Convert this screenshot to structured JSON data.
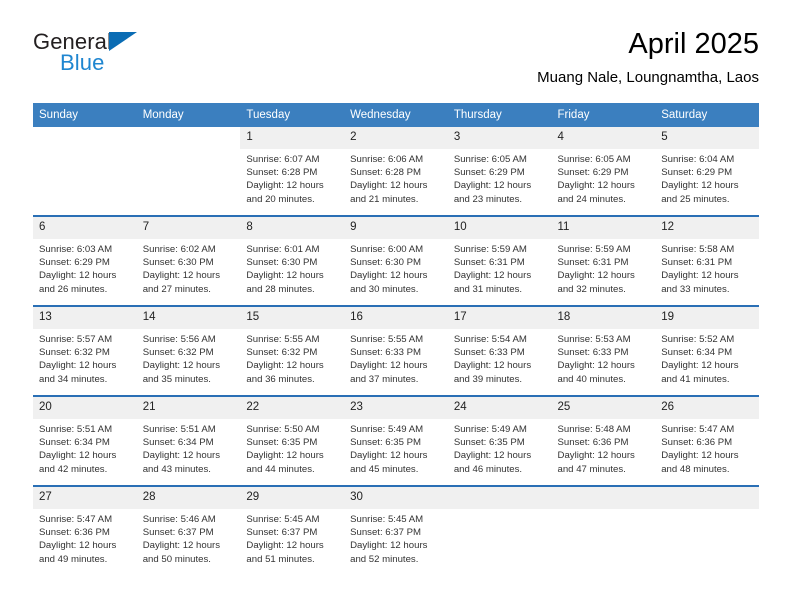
{
  "brand": {
    "name_part1": "General",
    "name_part2": "Blue",
    "triangle_icon": "logo-triangle-icon",
    "color_dark": "#231f20",
    "color_blue": "#1f86d0"
  },
  "header": {
    "title": "April 2025",
    "subtitle": "Muang Nale, Loungnamtha, Laos"
  },
  "theme": {
    "header_blue": "#3b7fbf",
    "row_divider_blue": "#2a6fb5",
    "daynum_bg": "#f0f0f0"
  },
  "calendar": {
    "weekday_headers": [
      "Sunday",
      "Monday",
      "Tuesday",
      "Wednesday",
      "Thursday",
      "Friday",
      "Saturday"
    ],
    "weeks": [
      [
        {
          "day": "",
          "sunrise": "",
          "sunset": "",
          "daylight_line1": "",
          "daylight_line2": "",
          "blank": true
        },
        {
          "day": "",
          "sunrise": "",
          "sunset": "",
          "daylight_line1": "",
          "daylight_line2": "",
          "blank": true
        },
        {
          "day": "1",
          "sunrise": "Sunrise: 6:07 AM",
          "sunset": "Sunset: 6:28 PM",
          "daylight_line1": "Daylight: 12 hours",
          "daylight_line2": "and 20 minutes."
        },
        {
          "day": "2",
          "sunrise": "Sunrise: 6:06 AM",
          "sunset": "Sunset: 6:28 PM",
          "daylight_line1": "Daylight: 12 hours",
          "daylight_line2": "and 21 minutes."
        },
        {
          "day": "3",
          "sunrise": "Sunrise: 6:05 AM",
          "sunset": "Sunset: 6:29 PM",
          "daylight_line1": "Daylight: 12 hours",
          "daylight_line2": "and 23 minutes."
        },
        {
          "day": "4",
          "sunrise": "Sunrise: 6:05 AM",
          "sunset": "Sunset: 6:29 PM",
          "daylight_line1": "Daylight: 12 hours",
          "daylight_line2": "and 24 minutes."
        },
        {
          "day": "5",
          "sunrise": "Sunrise: 6:04 AM",
          "sunset": "Sunset: 6:29 PM",
          "daylight_line1": "Daylight: 12 hours",
          "daylight_line2": "and 25 minutes."
        }
      ],
      [
        {
          "day": "6",
          "sunrise": "Sunrise: 6:03 AM",
          "sunset": "Sunset: 6:29 PM",
          "daylight_line1": "Daylight: 12 hours",
          "daylight_line2": "and 26 minutes."
        },
        {
          "day": "7",
          "sunrise": "Sunrise: 6:02 AM",
          "sunset": "Sunset: 6:30 PM",
          "daylight_line1": "Daylight: 12 hours",
          "daylight_line2": "and 27 minutes."
        },
        {
          "day": "8",
          "sunrise": "Sunrise: 6:01 AM",
          "sunset": "Sunset: 6:30 PM",
          "daylight_line1": "Daylight: 12 hours",
          "daylight_line2": "and 28 minutes."
        },
        {
          "day": "9",
          "sunrise": "Sunrise: 6:00 AM",
          "sunset": "Sunset: 6:30 PM",
          "daylight_line1": "Daylight: 12 hours",
          "daylight_line2": "and 30 minutes."
        },
        {
          "day": "10",
          "sunrise": "Sunrise: 5:59 AM",
          "sunset": "Sunset: 6:31 PM",
          "daylight_line1": "Daylight: 12 hours",
          "daylight_line2": "and 31 minutes."
        },
        {
          "day": "11",
          "sunrise": "Sunrise: 5:59 AM",
          "sunset": "Sunset: 6:31 PM",
          "daylight_line1": "Daylight: 12 hours",
          "daylight_line2": "and 32 minutes."
        },
        {
          "day": "12",
          "sunrise": "Sunrise: 5:58 AM",
          "sunset": "Sunset: 6:31 PM",
          "daylight_line1": "Daylight: 12 hours",
          "daylight_line2": "and 33 minutes."
        }
      ],
      [
        {
          "day": "13",
          "sunrise": "Sunrise: 5:57 AM",
          "sunset": "Sunset: 6:32 PM",
          "daylight_line1": "Daylight: 12 hours",
          "daylight_line2": "and 34 minutes."
        },
        {
          "day": "14",
          "sunrise": "Sunrise: 5:56 AM",
          "sunset": "Sunset: 6:32 PM",
          "daylight_line1": "Daylight: 12 hours",
          "daylight_line2": "and 35 minutes."
        },
        {
          "day": "15",
          "sunrise": "Sunrise: 5:55 AM",
          "sunset": "Sunset: 6:32 PM",
          "daylight_line1": "Daylight: 12 hours",
          "daylight_line2": "and 36 minutes."
        },
        {
          "day": "16",
          "sunrise": "Sunrise: 5:55 AM",
          "sunset": "Sunset: 6:33 PM",
          "daylight_line1": "Daylight: 12 hours",
          "daylight_line2": "and 37 minutes."
        },
        {
          "day": "17",
          "sunrise": "Sunrise: 5:54 AM",
          "sunset": "Sunset: 6:33 PM",
          "daylight_line1": "Daylight: 12 hours",
          "daylight_line2": "and 39 minutes."
        },
        {
          "day": "18",
          "sunrise": "Sunrise: 5:53 AM",
          "sunset": "Sunset: 6:33 PM",
          "daylight_line1": "Daylight: 12 hours",
          "daylight_line2": "and 40 minutes."
        },
        {
          "day": "19",
          "sunrise": "Sunrise: 5:52 AM",
          "sunset": "Sunset: 6:34 PM",
          "daylight_line1": "Daylight: 12 hours",
          "daylight_line2": "and 41 minutes."
        }
      ],
      [
        {
          "day": "20",
          "sunrise": "Sunrise: 5:51 AM",
          "sunset": "Sunset: 6:34 PM",
          "daylight_line1": "Daylight: 12 hours",
          "daylight_line2": "and 42 minutes."
        },
        {
          "day": "21",
          "sunrise": "Sunrise: 5:51 AM",
          "sunset": "Sunset: 6:34 PM",
          "daylight_line1": "Daylight: 12 hours",
          "daylight_line2": "and 43 minutes."
        },
        {
          "day": "22",
          "sunrise": "Sunrise: 5:50 AM",
          "sunset": "Sunset: 6:35 PM",
          "daylight_line1": "Daylight: 12 hours",
          "daylight_line2": "and 44 minutes."
        },
        {
          "day": "23",
          "sunrise": "Sunrise: 5:49 AM",
          "sunset": "Sunset: 6:35 PM",
          "daylight_line1": "Daylight: 12 hours",
          "daylight_line2": "and 45 minutes."
        },
        {
          "day": "24",
          "sunrise": "Sunrise: 5:49 AM",
          "sunset": "Sunset: 6:35 PM",
          "daylight_line1": "Daylight: 12 hours",
          "daylight_line2": "and 46 minutes."
        },
        {
          "day": "25",
          "sunrise": "Sunrise: 5:48 AM",
          "sunset": "Sunset: 6:36 PM",
          "daylight_line1": "Daylight: 12 hours",
          "daylight_line2": "and 47 minutes."
        },
        {
          "day": "26",
          "sunrise": "Sunrise: 5:47 AM",
          "sunset": "Sunset: 6:36 PM",
          "daylight_line1": "Daylight: 12 hours",
          "daylight_line2": "and 48 minutes."
        }
      ],
      [
        {
          "day": "27",
          "sunrise": "Sunrise: 5:47 AM",
          "sunset": "Sunset: 6:36 PM",
          "daylight_line1": "Daylight: 12 hours",
          "daylight_line2": "and 49 minutes."
        },
        {
          "day": "28",
          "sunrise": "Sunrise: 5:46 AM",
          "sunset": "Sunset: 6:37 PM",
          "daylight_line1": "Daylight: 12 hours",
          "daylight_line2": "and 50 minutes."
        },
        {
          "day": "29",
          "sunrise": "Sunrise: 5:45 AM",
          "sunset": "Sunset: 6:37 PM",
          "daylight_line1": "Daylight: 12 hours",
          "daylight_line2": "and 51 minutes."
        },
        {
          "day": "30",
          "sunrise": "Sunrise: 5:45 AM",
          "sunset": "Sunset: 6:37 PM",
          "daylight_line1": "Daylight: 12 hours",
          "daylight_line2": "and 52 minutes."
        },
        {
          "day": "",
          "sunrise": "",
          "sunset": "",
          "daylight_line1": "",
          "daylight_line2": "",
          "empty": true
        },
        {
          "day": "",
          "sunrise": "",
          "sunset": "",
          "daylight_line1": "",
          "daylight_line2": "",
          "empty": true
        },
        {
          "day": "",
          "sunrise": "",
          "sunset": "",
          "daylight_line1": "",
          "daylight_line2": "",
          "empty": true
        }
      ]
    ]
  }
}
